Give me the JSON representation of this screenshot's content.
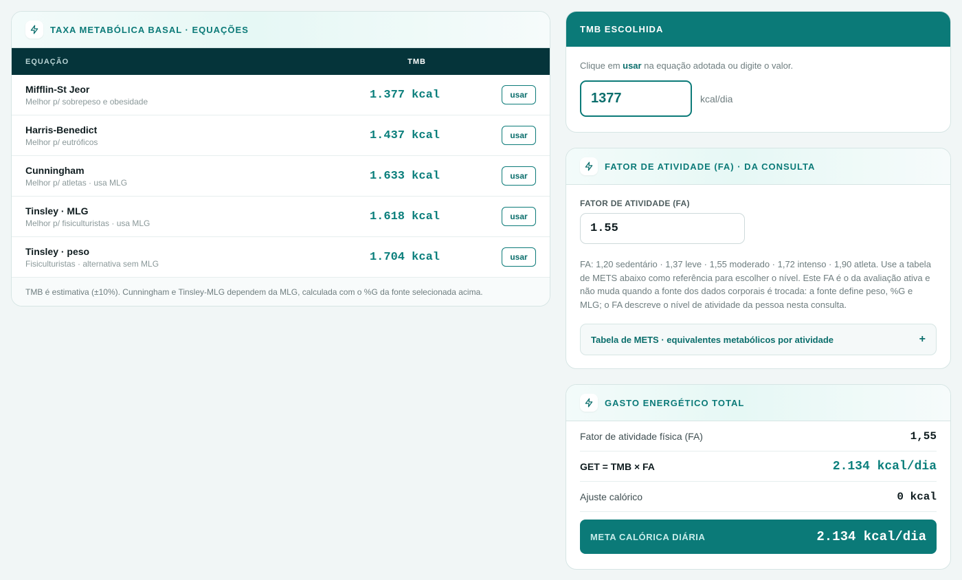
{
  "tmb_card": {
    "title": "TAXA METABÓLICA BASAL · EQUAÇÕES",
    "icon": "bolt-icon",
    "col_equation": "EQUAÇÃO",
    "col_tmb": "TMB",
    "rows": [
      {
        "name": "Mifflin-St Jeor",
        "desc": "Melhor p/ sobrepeso e obesidade",
        "value": "1.377 kcal",
        "button": "usar"
      },
      {
        "name": "Harris-Benedict",
        "desc": "Melhor p/ eutróficos",
        "value": "1.437 kcal",
        "button": "usar"
      },
      {
        "name": "Cunningham",
        "desc": "Melhor p/ atletas · usa MLG",
        "value": "1.633 kcal",
        "button": "usar"
      },
      {
        "name": "Tinsley · MLG",
        "desc": "Melhor p/ fisiculturistas · usa MLG",
        "value": "1.618 kcal",
        "button": "usar"
      },
      {
        "name": "Tinsley · peso",
        "desc": "Fisiculturistas · alternativa sem MLG",
        "value": "1.704 kcal",
        "button": "usar"
      }
    ],
    "note": "TMB é estimativa (±10%). Cunningham e Tinsley-MLG dependem da MLG, calculada com o %G da fonte selecionada acima."
  },
  "chosen_card": {
    "title": "TMB ESCOLHIDA",
    "hint_prefix": "Clique em ",
    "hint_keyword": "usar",
    "hint_suffix": " na equação adotada ou digite o valor.",
    "value": "1377",
    "unit": "kcal/dia"
  },
  "fa_card": {
    "title": "FATOR DE ATIVIDADE (FA) · DA CONSULTA",
    "icon": "bolt-icon",
    "field_label": "FATOR DE ATIVIDADE (FA)",
    "field_value": "1.55",
    "help": "FA: 1,20 sedentário · 1,37 leve · 1,55 moderado · 1,72 intenso · 1,90 atleta. Use a tabela de METS abaixo como referência para escolher o nível. Este FA é o da avaliação ativa e não muda quando a fonte dos dados corporais é trocada: a fonte define peso, %G e MLG; o FA descreve o nível de atividade da pessoa nesta consulta.",
    "mets_toggle": "Tabela de METS · equivalentes metabólicos por atividade",
    "mets_toggle_icon": "+"
  },
  "get_card": {
    "title": "GASTO ENERGÉTICO TOTAL",
    "icon": "bolt-icon",
    "rows": [
      {
        "label": "Fator de atividade física (FA)",
        "value": "1,55"
      },
      {
        "label": "GET = TMB × FA",
        "value": "2.134 kcal/dia"
      },
      {
        "label": "Ajuste calórico",
        "value": "0 kcal"
      }
    ],
    "meta_label": "META CALÓRICA DIÁRIA",
    "meta_value": "2.134 kcal/dia"
  },
  "colors": {
    "accent": "#0b7a78",
    "table_header": "#05343a",
    "background": "#f1f6f6"
  }
}
